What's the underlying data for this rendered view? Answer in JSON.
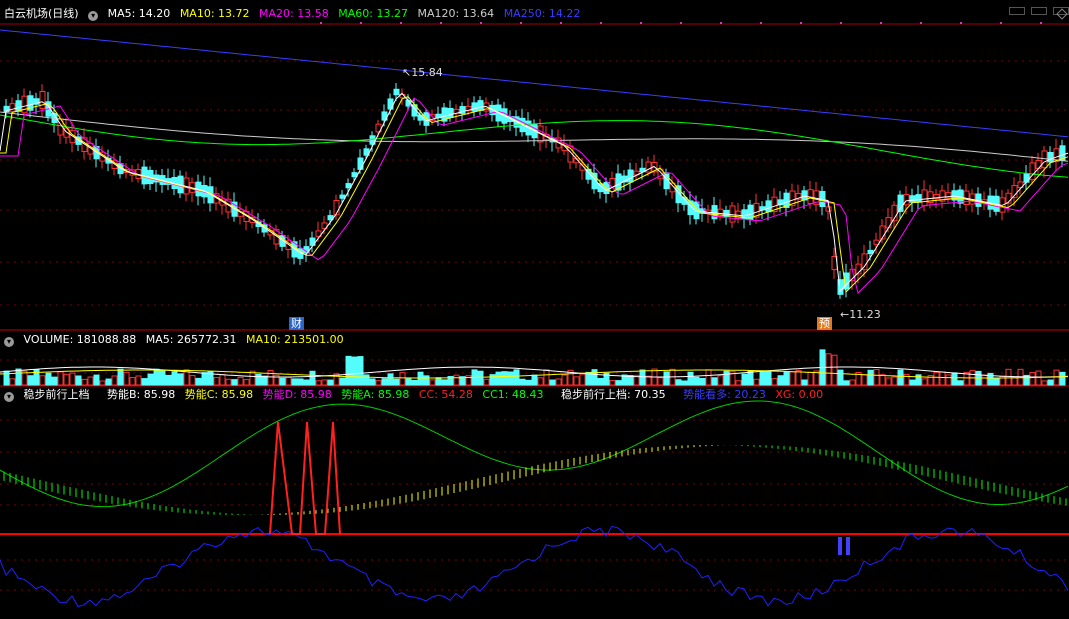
{
  "main": {
    "title": "白云机场(日线)",
    "ma": [
      {
        "label": "MA5: 14.20",
        "color": "#ffffff"
      },
      {
        "label": "MA10: 13.72",
        "color": "#ffff00"
      },
      {
        "label": "MA20: 13.58",
        "color": "#ff00ff"
      },
      {
        "label": "MA60: 13.27",
        "color": "#00ff00"
      },
      {
        "label": "MA120: 13.64",
        "color": "#cccccc"
      },
      {
        "label": "MA250: 14.22",
        "color": "#3b3bff"
      }
    ],
    "high_label": "15.84",
    "low_label": "11.23",
    "marker_cai": "财",
    "marker_yu": "预"
  },
  "volume": {
    "label": "VOLUME: 181088.88",
    "ma5": "MA5: 265772.31",
    "ma10": "MA10: 213501.00"
  },
  "indicator": {
    "name": "稳步前行上档",
    "fields": [
      {
        "label": "势能B: 85.98",
        "color": "#ffffff"
      },
      {
        "label": "势能C: 85.98",
        "color": "#ffff00"
      },
      {
        "label": "势能D: 85.98",
        "color": "#ff00ff"
      },
      {
        "label": "势能A: 85.98",
        "color": "#00ff00"
      },
      {
        "label": "CC: 54.28",
        "color": "#ff2020"
      },
      {
        "label": "CC1: 48.43",
        "color": "#00ff00"
      },
      {
        "label": "稳步前行上档: 70.35",
        "color": "#ffffff"
      },
      {
        "label": "势能看多: 20.23",
        "color": "#3b3bff"
      },
      {
        "label": "XG: 0.00",
        "color": "#ff2020"
      }
    ]
  },
  "colors": {
    "up": "#ff3232",
    "down": "#54fcfc",
    "grid": "#7a0000",
    "accent": "#ff0000"
  }
}
